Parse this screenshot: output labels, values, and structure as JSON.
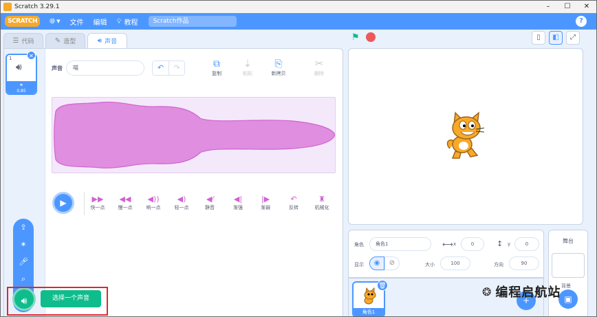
{
  "window": {
    "title": "Scratch 3.29.1",
    "controls": [
      "–",
      "☐",
      "✕"
    ]
  },
  "menubar": {
    "logo": "SCRATCH",
    "items": [
      {
        "icon": "globe-icon",
        "label": ""
      },
      {
        "icon": "file-icon",
        "label": "文件"
      },
      {
        "icon": "edit-icon",
        "label": "编辑"
      },
      {
        "icon": "bulb-icon",
        "label": "教程"
      }
    ],
    "project_name": "Scratch作品",
    "help": "?"
  },
  "tabs": [
    {
      "label": "代码",
      "icon": "code-icon",
      "active": false
    },
    {
      "label": "造型",
      "icon": "brush-icon",
      "active": false
    },
    {
      "label": "声音",
      "icon": "speaker-icon",
      "active": true
    }
  ],
  "sound_list": {
    "items": [
      {
        "index": "1",
        "duration": "0.85"
      }
    ],
    "add_tooltip": "选择一个声音"
  },
  "sound_editor": {
    "name_label": "声音",
    "name_value": "喵",
    "tools": [
      {
        "label": "复制",
        "icon": "copy-icon",
        "enabled": true
      },
      {
        "label": "粘贴",
        "icon": "paste-icon",
        "enabled": false
      },
      {
        "label": "新拷贝",
        "icon": "new-copy-icon",
        "enabled": true
      },
      {
        "label": "删除",
        "icon": "scissors-icon",
        "enabled": false
      }
    ],
    "effects": [
      {
        "label": "快一点",
        "icon": "faster-icon"
      },
      {
        "label": "慢一点",
        "icon": "slower-icon"
      },
      {
        "label": "响一点",
        "icon": "louder-icon"
      },
      {
        "label": "轻一点",
        "icon": "softer-icon"
      },
      {
        "label": "静音",
        "icon": "mute-icon"
      },
      {
        "label": "渐强",
        "icon": "fade-in-icon"
      },
      {
        "label": "渐弱",
        "icon": "fade-out-icon"
      },
      {
        "label": "反转",
        "icon": "reverse-icon"
      },
      {
        "label": "机械化",
        "icon": "robot-icon"
      }
    ],
    "waveform_color": "#cf63cf"
  },
  "sprite_info": {
    "sprite_label": "角色",
    "sprite_name": "角色1",
    "x_label": "x",
    "x_value": "0",
    "y_label": "y",
    "y_value": "0",
    "show_label": "显示",
    "size_label": "大小",
    "size_value": "100",
    "direction_label": "方向",
    "direction_value": "90"
  },
  "sprites": [
    {
      "name": "角色1"
    }
  ],
  "stage_panel": {
    "title": "舞台",
    "backdrop_label": "背景"
  },
  "watermark": "编程启航站",
  "colors": {
    "accent": "#4c97ff",
    "green": "#0fbd8c",
    "sound": "#cf63cf",
    "highlight": "#e4252b"
  }
}
